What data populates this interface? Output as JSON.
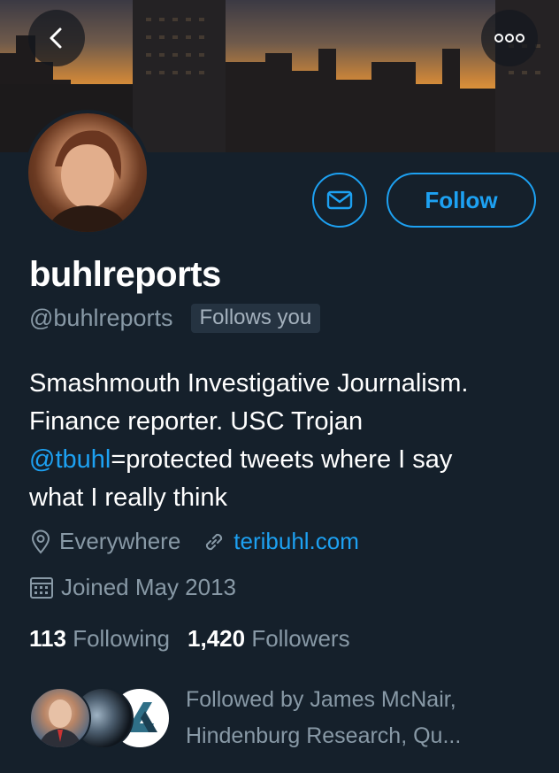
{
  "profile": {
    "display_name": "buhlreports",
    "handle": "@buhlreports",
    "follows_you": "Follows you",
    "bio_line1": "Smashmouth Investigative Journalism.",
    "bio_line2": "Finance reporter. USC Trojan",
    "bio_mention": "@tbuhl",
    "bio_line3_rest": "=protected tweets where I say",
    "bio_line4": "what I really think",
    "location": "Everywhere",
    "website": "teribuhl.com",
    "joined": "Joined May 2013",
    "following_count": "113",
    "following_label": "Following",
    "followers_count": "1,420",
    "followers_label": "Followers",
    "followed_by_line1": "Followed by James McNair,",
    "followed_by_line2": "Hindenburg Research, Qu..."
  },
  "actions": {
    "follow_label": "Follow"
  },
  "icons": {
    "back": "chevron-left-icon",
    "more": "more-dots-icon",
    "message": "envelope-icon",
    "location": "location-pin-icon",
    "link": "link-icon",
    "calendar": "calendar-icon"
  },
  "colors": {
    "background": "#15202b",
    "accent": "#1da1f2",
    "secondary_text": "#8899a6"
  }
}
